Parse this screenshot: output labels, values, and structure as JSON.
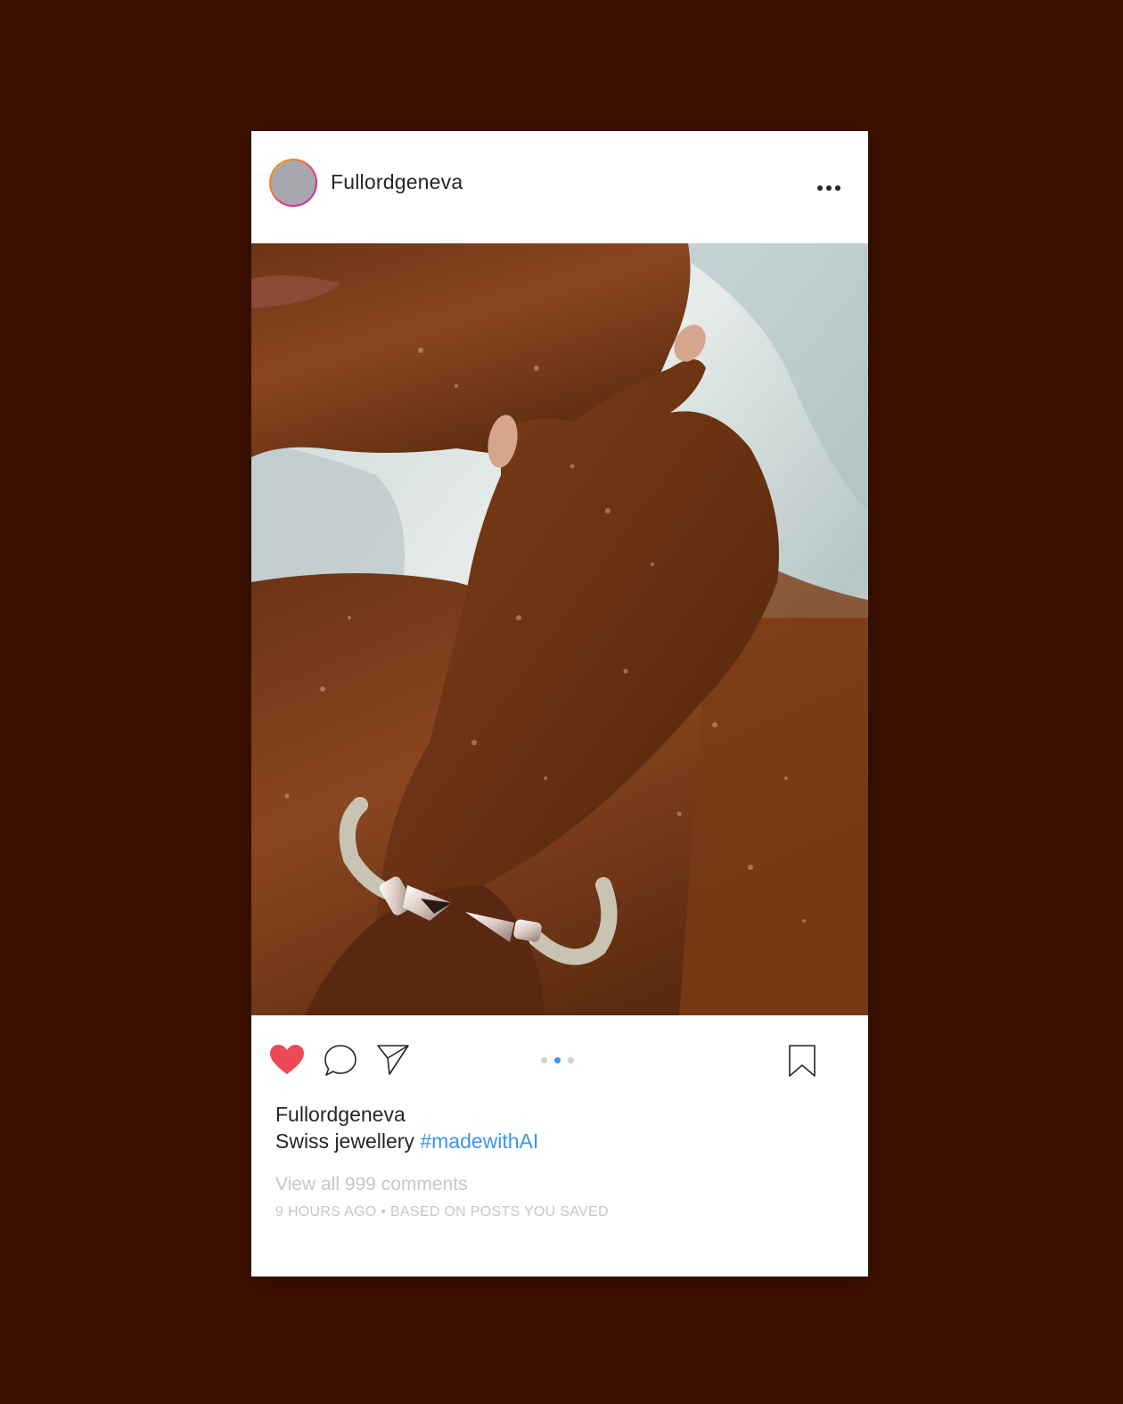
{
  "post": {
    "username": "Fullordgeneva",
    "photo_alt": "Photo",
    "liked": true,
    "carousel": {
      "count": 3,
      "active_index": 1
    },
    "caption": {
      "username": "Fullordgeneva",
      "text": "Swiss jewellery",
      "hashtag": "#madewithAI"
    },
    "view_comments": "View all 999 comments",
    "meta": "9 HOURS AGO • BASED ON POSTS YOU SAVED"
  },
  "icons": {
    "more": "more-options-icon",
    "like": "heart-icon",
    "comment": "comment-icon",
    "share": "paper-plane-icon",
    "save": "bookmark-icon"
  },
  "colors": {
    "background": "#3f1100",
    "card": "#ffffff",
    "like": "#ed4956",
    "link": "#3897f0",
    "muted": "#c7c7c7",
    "text": "#262626"
  }
}
